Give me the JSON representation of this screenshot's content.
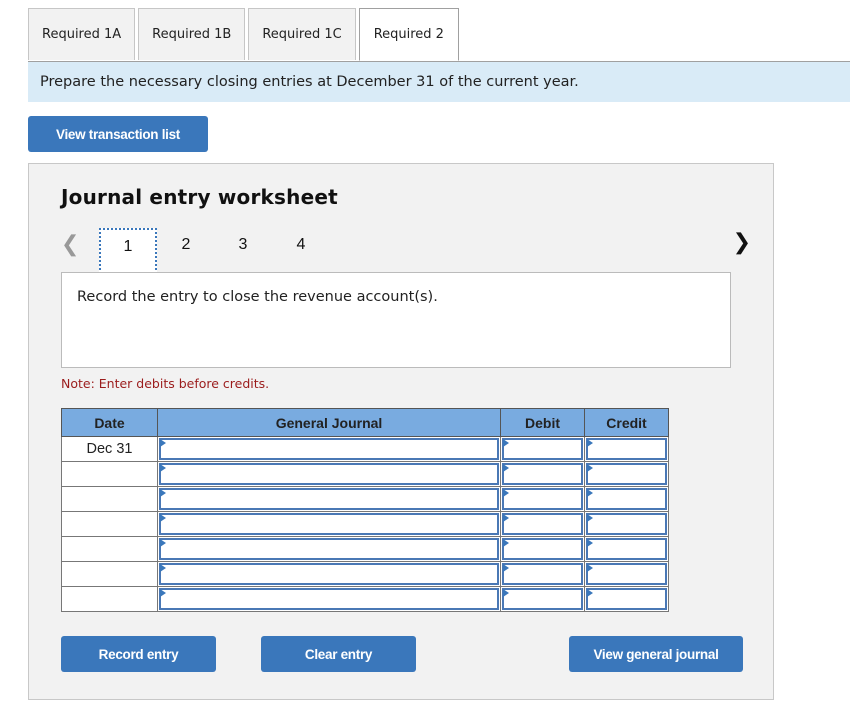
{
  "tabs": [
    {
      "label": "Required 1A",
      "active": false
    },
    {
      "label": "Required 1B",
      "active": false
    },
    {
      "label": "Required 1C",
      "active": false
    },
    {
      "label": "Required 2",
      "active": true
    }
  ],
  "instruction": "Prepare the necessary closing entries at December 31 of the current year.",
  "view_transaction_list": "View transaction list",
  "worksheet": {
    "title": "Journal entry worksheet",
    "pages": [
      "1",
      "2",
      "3",
      "4"
    ],
    "current_page": "1",
    "prev_icon": "chevron-left-icon",
    "next_icon": "chevron-right-icon",
    "prompt": "Record the entry to close the revenue account(s).",
    "note": "Note: Enter debits before credits.",
    "table": {
      "headers": [
        "Date",
        "General Journal",
        "Debit",
        "Credit"
      ],
      "rows": [
        {
          "date": "Dec 31",
          "account": "",
          "debit": "",
          "credit": ""
        },
        {
          "date": "",
          "account": "",
          "debit": "",
          "credit": ""
        },
        {
          "date": "",
          "account": "",
          "debit": "",
          "credit": ""
        },
        {
          "date": "",
          "account": "",
          "debit": "",
          "credit": ""
        },
        {
          "date": "",
          "account": "",
          "debit": "",
          "credit": ""
        },
        {
          "date": "",
          "account": "",
          "debit": "",
          "credit": ""
        },
        {
          "date": "",
          "account": "",
          "debit": "",
          "credit": ""
        }
      ]
    },
    "buttons": {
      "record": "Record entry",
      "clear": "Clear entry",
      "view_general_journal": "View general journal"
    }
  },
  "colors": {
    "accent": "#3a77bb",
    "header_blue": "#79abe0",
    "instruction_bg": "#d9ebf7",
    "note_red": "#9b1c1c"
  }
}
